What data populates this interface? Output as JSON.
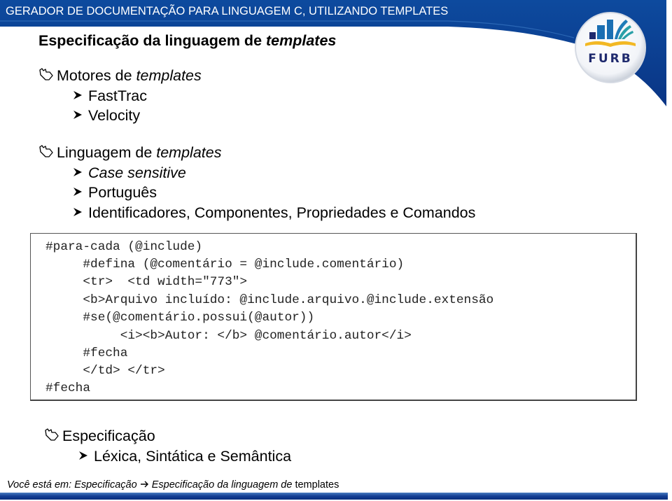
{
  "header": {
    "title": "GERADOR DE DOCUMENTAÇÃO PARA LINGUAGEM C, UTILIZANDO TEMPLATES",
    "brand_color": "#0b3a8c",
    "logo": {
      "icon": "furb-logo",
      "text": "FURB",
      "colors": {
        "navy": "#1f2a6e",
        "blue": "#1b6fb3",
        "teal": "#2aa0a8",
        "gold": "#f2b824"
      }
    }
  },
  "slide": {
    "title_prefix": "Especificação da linguagem de ",
    "title_italic": "templates",
    "sections": [
      {
        "icon": "hand-arrow-icon",
        "label_prefix": "Motores de ",
        "label_italic": "templates",
        "items": [
          {
            "icon": "chevron-right-icon",
            "label": "FastTrac"
          },
          {
            "icon": "chevron-right-icon",
            "label": "Velocity"
          }
        ]
      },
      {
        "icon": "hand-arrow-icon",
        "label_prefix": "Linguagem de ",
        "label_italic": "templates",
        "items": [
          {
            "icon": "chevron-right-icon",
            "label": "Case sensitive",
            "italic": true
          },
          {
            "icon": "chevron-right-icon",
            "label": "Português"
          },
          {
            "icon": "chevron-right-icon",
            "label": "Identificadores, Componentes, Propriedades e Comandos"
          }
        ]
      },
      {
        "icon": "hand-arrow-icon",
        "label_prefix": "Especificação",
        "label_italic": "",
        "items": [
          {
            "icon": "chevron-right-icon",
            "label": "Léxica, Sintática e Semântica"
          }
        ]
      }
    ],
    "code": [
      "#para-cada (@include)",
      "     #defina (@comentário = @include.comentário)",
      "     <tr>  <td width=\"773\">",
      "     <b>Arquivo incluído: @include.arquivo.@include.extensão",
      "     #se(@comentário.possui(@autor))",
      "          <i><b>Autor: </b> @comentário.autor</i>",
      "     #fecha",
      "     </td> </tr>",
      "#fecha"
    ]
  },
  "footer": {
    "breadcrumb_prefix": "Você está em: ",
    "crumbs": [
      "Especificação",
      "Especificação da linguagem de "
    ],
    "separator_icon": "arrow-right-icon",
    "last_crumb_normal": "templates"
  }
}
